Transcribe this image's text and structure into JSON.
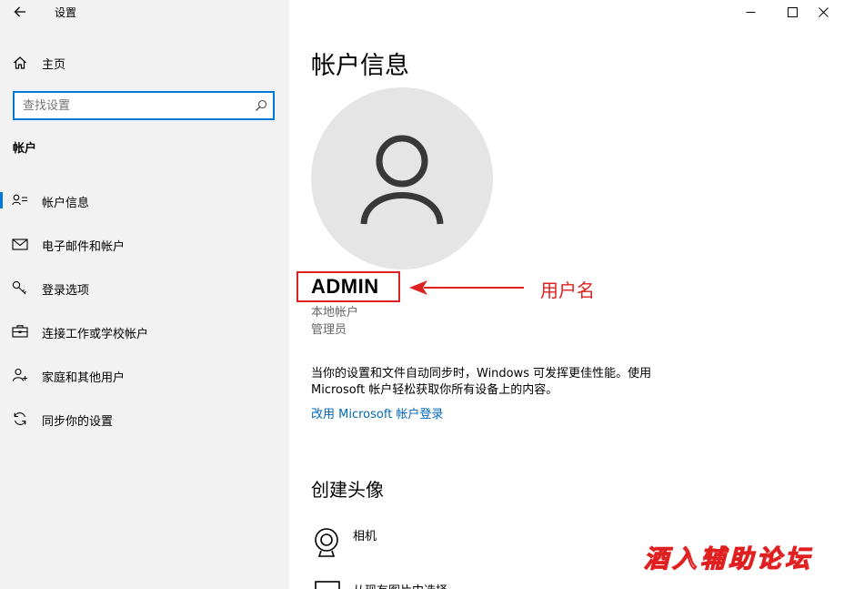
{
  "window": {
    "title": "设置",
    "controls": [
      "minimize",
      "maximize",
      "close"
    ]
  },
  "sidebar": {
    "home_label": "主页",
    "search_placeholder": "查找设置",
    "section_title": "帐户",
    "items": [
      {
        "label": "帐户信息",
        "icon": "account-info-icon",
        "active": true
      },
      {
        "label": "电子邮件和帐户",
        "icon": "mail-icon",
        "active": false
      },
      {
        "label": "登录选项",
        "icon": "key-icon",
        "active": false
      },
      {
        "label": "连接工作或学校帐户",
        "icon": "briefcase-icon",
        "active": false
      },
      {
        "label": "家庭和其他用户",
        "icon": "person-add-icon",
        "active": false
      },
      {
        "label": "同步你的设置",
        "icon": "sync-icon",
        "active": false
      }
    ]
  },
  "main": {
    "title": "帐户信息",
    "username": "ADMIN",
    "annotation": "用户名",
    "account_type": "本地帐户",
    "account_role": "管理员",
    "description_line1": "当你的设置和文件自动同步时，Windows 可发挥更佳性能。使用",
    "description_line2": "Microsoft 帐户轻松获取你所有设备上的内容。",
    "ms_link": "改用 Microsoft 帐户登录",
    "create_avatar_title": "创建头像",
    "camera_label": "相机",
    "browse_label": "从现有图片中选择"
  },
  "watermark": "酒入辅助论坛",
  "colors": {
    "accent": "#0078d7",
    "link": "#0067b8",
    "annotation": "#e02020",
    "sidebar_bg": "#f2f2f2",
    "avatar_bg": "#e5e5e5"
  }
}
